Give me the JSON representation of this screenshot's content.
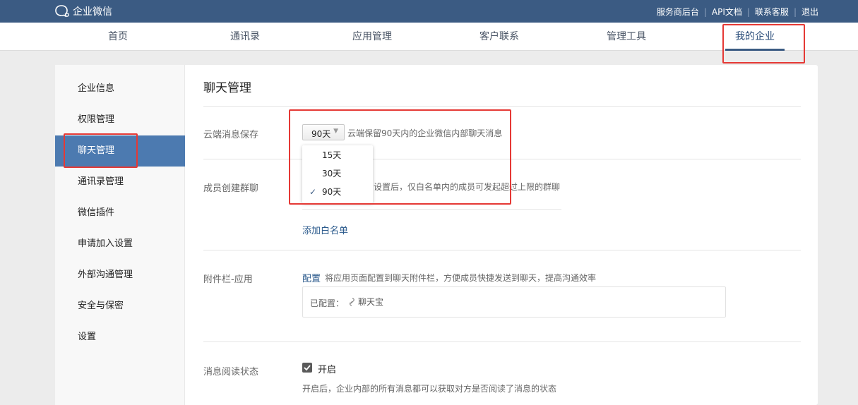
{
  "topbar": {
    "logo_text": "企业微信",
    "links": [
      "服务商后台",
      "API文档",
      "联系客服",
      "退出"
    ],
    "separator": "|"
  },
  "nav": {
    "items": [
      "首页",
      "通讯录",
      "应用管理",
      "客户联系",
      "管理工具",
      "我的企业"
    ],
    "active": "我的企业"
  },
  "sidebar": {
    "items": [
      "企业信息",
      "权限管理",
      "聊天管理",
      "通讯录管理",
      "微信插件",
      "申请加入设置",
      "外部沟通管理",
      "安全与保密",
      "设置"
    ],
    "active": "聊天管理"
  },
  "main": {
    "title": "聊天管理",
    "cloud_storage": {
      "label": "云端消息保存",
      "selected": "90天",
      "hint": "云端保留90天内的企业微信内部聊天消息",
      "options": [
        "15天",
        "30天",
        "90天"
      ],
      "checked_option": "90天"
    },
    "group_chat": {
      "label": "成员创建群聊",
      "hint_visible": "设置后，仅白名单内的成员可发起超过上限的群聊",
      "add_whitelist": "添加白名单"
    },
    "attachment": {
      "label": "附件栏-应用",
      "config_link": "配置",
      "description": "将应用页面配置到聊天附件栏，方便成员快捷发送到聊天，提高沟通效率",
      "configured_label": "已配置：",
      "app_name": "聊天宝"
    },
    "read_status": {
      "label": "消息阅读状态",
      "checkbox_label": "开启",
      "checked": true,
      "description": "开启后，企业内部的所有消息都可以获取对方是否阅读了消息的状态"
    }
  },
  "colors": {
    "topbar_bg": "#3b5b83",
    "sidebar_active_bg": "#4c7ab0",
    "link_blue": "#2b5a8c",
    "annotation_red": "#e53935"
  }
}
